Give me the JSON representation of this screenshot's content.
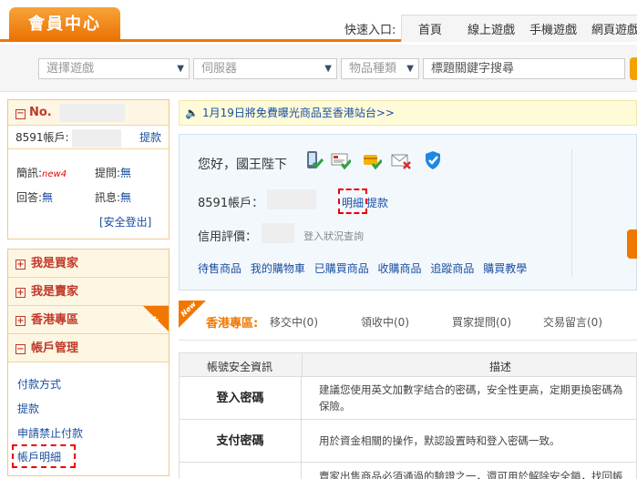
{
  "header": {
    "member_center": "會員中心",
    "quick_entry": "快速入口:",
    "quick_links": [
      "首頁",
      "線上遊戲",
      "手機遊戲",
      "網頁遊戲"
    ]
  },
  "search": {
    "game_select": "選擇遊戲",
    "server_select": "伺服器",
    "item_type_select": "物品種類",
    "keyword_placeholder": "標題關鍵字搜尋"
  },
  "sidebar": {
    "no_label": "No.",
    "account_label": "8591帳戶:",
    "withdraw": "提款",
    "messages_label": "簡訊:",
    "messages_value": "new4",
    "questions_label": "提問:",
    "questions_value": "無",
    "answers_label": "回答:",
    "answers_value": "無",
    "notices_label": "訊息:",
    "notices_value": "無",
    "logout": "[安全登出]",
    "menu": [
      "我是買家",
      "我是賣家",
      "香港專區",
      "帳戶管理"
    ],
    "new_badge": "New",
    "account_mgmt_items": [
      "付款方式",
      "提款",
      "申請禁止付款",
      "帳戶明細"
    ]
  },
  "notice": {
    "text": "1月19日將免費曝光商品至香港站台>>"
  },
  "panel": {
    "greeting": "您好，國王陛下",
    "account_label": "8591帳戶：",
    "detail_link": "明細",
    "withdraw_link": "提款",
    "credit_label": "信用評價：",
    "login_status_link": "登入狀況查詢",
    "quick_links": [
      "待售商品",
      "我的購物車",
      "已購買商品",
      "收購商品",
      "追蹤商品",
      "購買教學"
    ]
  },
  "hk": {
    "badge": "New",
    "title": "香港專區:",
    "items": [
      "移交中(0)",
      "領收中(0)",
      "買家提問(0)",
      "交易留言(0)"
    ]
  },
  "security_table": {
    "col1": "帳號安全資訊",
    "col2": "描述",
    "rows": [
      {
        "name": "登入密碼",
        "desc1": "建議您使用英文加數字結合的密碼，安全性更高，定期更換密碼為",
        "desc2": "保險。"
      },
      {
        "name": "支付密碼",
        "desc1": "用於資金相關的操作，默認設置時和登入密碼一致。",
        "desc2": ""
      },
      {
        "name": "",
        "desc1": "賣家出售商品必須通過的驗證之一，還可用於解除安全鎖，找回帳",
        "desc2": ""
      }
    ]
  },
  "colors": {
    "brand_orange": "#f07800",
    "link_blue": "#1a4fa0",
    "menu_red": "#c0392b"
  }
}
